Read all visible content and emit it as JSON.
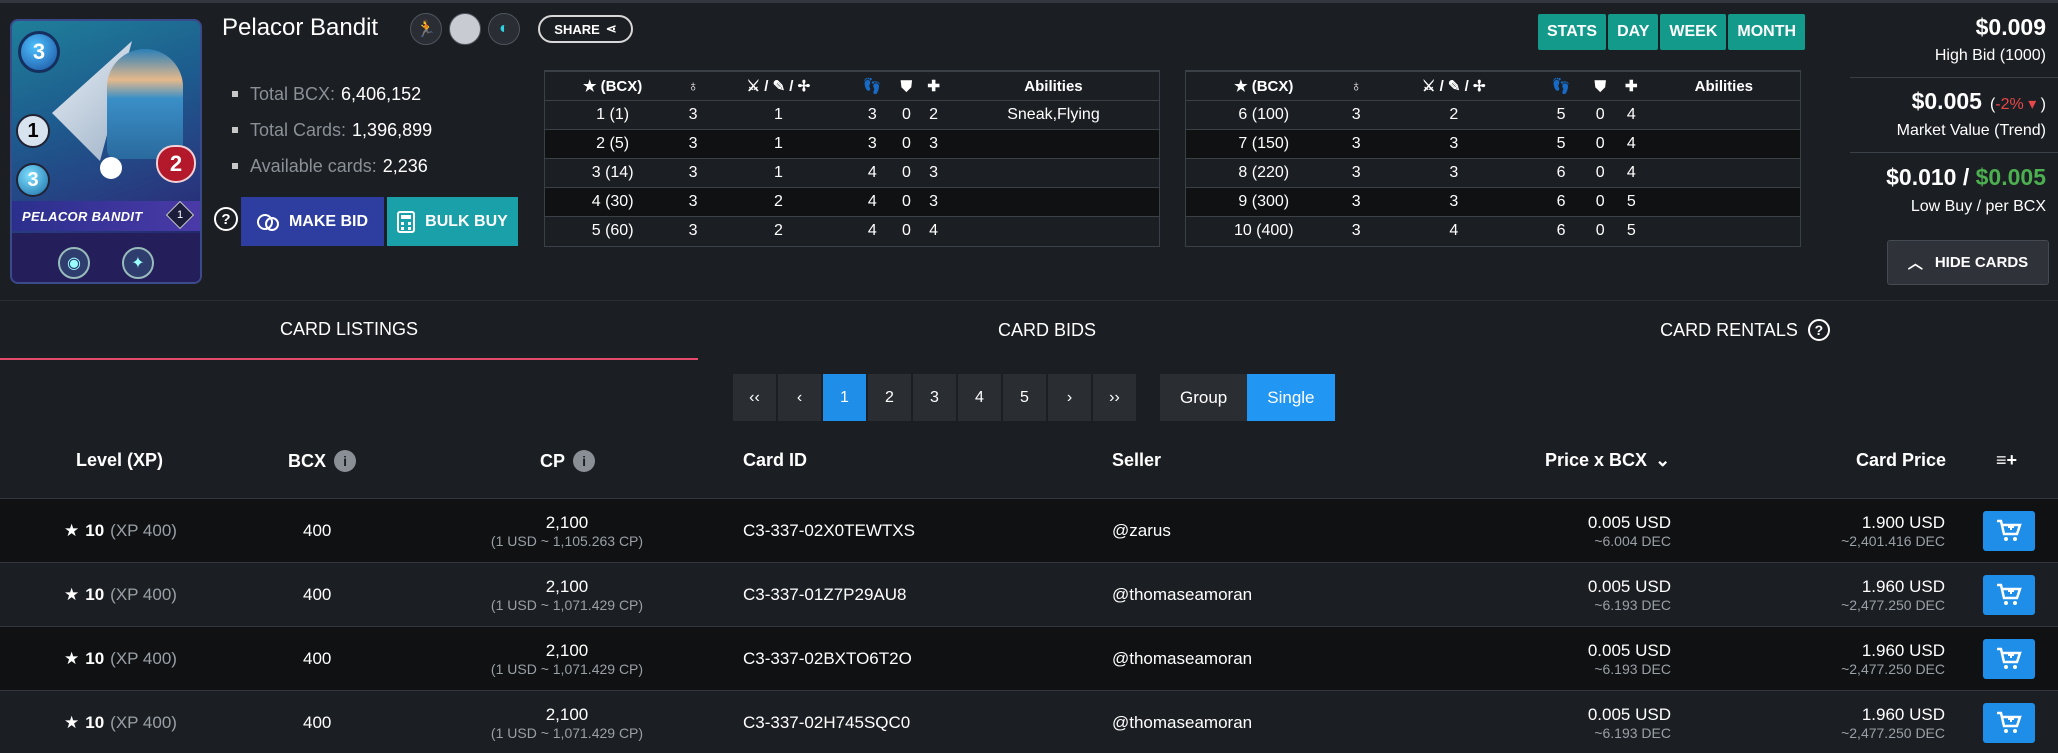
{
  "card": {
    "name": "Pelacor Bandit",
    "art": {
      "mana": "3",
      "melee": "1",
      "speed": "3",
      "health": "2",
      "plate_name": "PELACOR BANDIT",
      "level": "1"
    },
    "info": [
      {
        "label": "Total BCX:",
        "value": "6,406,152"
      },
      {
        "label": "Total Cards:",
        "value": "1,396,899"
      },
      {
        "label": "Available cards:",
        "value": "2,236"
      }
    ],
    "share_label": "SHARE",
    "make_bid_label": "MAKE BID",
    "bulk_buy_label": "BULK BUY"
  },
  "stats_headers": [
    "(BCX)",
    "",
    "/ /",
    "",
    "",
    "",
    "Abilities"
  ],
  "stats_table_1": [
    [
      "1 (1)",
      "3",
      "1",
      "3",
      "0",
      "2",
      "Sneak,Flying"
    ],
    [
      "2 (5)",
      "3",
      "1",
      "3",
      "0",
      "3",
      ""
    ],
    [
      "3 (14)",
      "3",
      "1",
      "4",
      "0",
      "3",
      ""
    ],
    [
      "4 (30)",
      "3",
      "2",
      "4",
      "0",
      "3",
      ""
    ],
    [
      "5 (60)",
      "3",
      "2",
      "4",
      "0",
      "4",
      ""
    ]
  ],
  "stats_table_2": [
    [
      "6 (100)",
      "3",
      "2",
      "5",
      "0",
      "4",
      ""
    ],
    [
      "7 (150)",
      "3",
      "3",
      "5",
      "0",
      "4",
      ""
    ],
    [
      "8 (220)",
      "3",
      "3",
      "6",
      "0",
      "4",
      ""
    ],
    [
      "9 (300)",
      "3",
      "3",
      "6",
      "0",
      "5",
      ""
    ],
    [
      "10 (400)",
      "3",
      "4",
      "6",
      "0",
      "5",
      ""
    ]
  ],
  "range_tabs": [
    "STATS",
    "DAY",
    "WEEK",
    "MONTH"
  ],
  "prices": {
    "high_bid": "$0.009",
    "high_bid_label": "High Bid (1000)",
    "market_value": "$0.005",
    "market_trend": "-2%",
    "market_label": "Market Value (Trend)",
    "low_buy": "$0.010",
    "per_bcx": "$0.005",
    "low_buy_label": "Low Buy / per BCX"
  },
  "hide_cards_label": "HIDE CARDS",
  "section_tabs": {
    "listings": "CARD LISTINGS",
    "bids": "CARD BIDS",
    "rentals": "CARD RENTALS"
  },
  "pager": {
    "first": "‹‹",
    "prev": "‹",
    "pages": [
      "1",
      "2",
      "3",
      "4",
      "5"
    ],
    "next": "›",
    "last": "››"
  },
  "view_toggle": {
    "group": "Group",
    "single": "Single"
  },
  "listing_headers": {
    "level": "Level (XP)",
    "bcx": "BCX",
    "cp": "CP",
    "card_id": "Card ID",
    "seller": "Seller",
    "price_bcx": "Price x BCX",
    "card_price": "Card Price",
    "columns": "≡+"
  },
  "listings": [
    {
      "level": "10",
      "xp": "(XP 400)",
      "bcx": "400",
      "cp": "2,100",
      "cp_rate": "(1 USD ~ 1,105.263 CP)",
      "card_id": "C3-337-02X0TEWTXS",
      "seller": "@zarus",
      "price_bcx": "0.005 USD",
      "price_bcx_dec": "~6.004 DEC",
      "card_price": "1.900 USD",
      "card_price_dec": "~2,401.416 DEC"
    },
    {
      "level": "10",
      "xp": "(XP 400)",
      "bcx": "400",
      "cp": "2,100",
      "cp_rate": "(1 USD ~ 1,071.429 CP)",
      "card_id": "C3-337-01Z7P29AU8",
      "seller": "@thomaseamoran",
      "price_bcx": "0.005 USD",
      "price_bcx_dec": "~6.193 DEC",
      "card_price": "1.960 USD",
      "card_price_dec": "~2,477.250 DEC"
    },
    {
      "level": "10",
      "xp": "(XP 400)",
      "bcx": "400",
      "cp": "2,100",
      "cp_rate": "(1 USD ~ 1,071.429 CP)",
      "card_id": "C3-337-02BXTO6T2O",
      "seller": "@thomaseamoran",
      "price_bcx": "0.005 USD",
      "price_bcx_dec": "~6.193 DEC",
      "card_price": "1.960 USD",
      "card_price_dec": "~2,477.250 DEC"
    },
    {
      "level": "10",
      "xp": "(XP 400)",
      "bcx": "400",
      "cp": "2,100",
      "cp_rate": "(1 USD ~ 1,071.429 CP)",
      "card_id": "C3-337-02H745SQC0",
      "seller": "@thomaseamoran",
      "price_bcx": "0.005 USD",
      "price_bcx_dec": "~6.193 DEC",
      "card_price": "1.960 USD",
      "card_price_dec": "~2,477.250 DEC"
    }
  ],
  "colors": {
    "accent_teal": "#139a8b",
    "accent_blue": "#1e8ee8",
    "trend_down": "#e8474a",
    "positive": "#4caf50",
    "tab_underline": "#e44a6a"
  }
}
